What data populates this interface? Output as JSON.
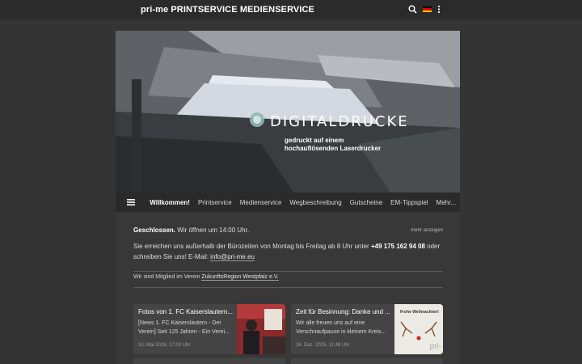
{
  "header": {
    "title": "pri-me PRINTSERVICE MEDIENSERVICE",
    "icons": [
      "search-icon",
      "flag-de-icon",
      "more-vert-icon"
    ]
  },
  "hero": {
    "title": "DIGITALDRUCKE",
    "subtitle": "gedruckt auf einem hochauflösenden Laserdrucker"
  },
  "nav": {
    "items": [
      {
        "label": "Willkommen!",
        "active": true
      },
      {
        "label": "Printservice"
      },
      {
        "label": "Medienservice"
      },
      {
        "label": "Wegbeschreibung"
      },
      {
        "label": "Gutscheine"
      },
      {
        "label": "EM-Tippspiel"
      },
      {
        "label": "Mehr..."
      }
    ]
  },
  "status": {
    "closed": "Geschlossen.",
    "opens": "Wir öffnen um 14:00 Uhr.",
    "more": "mehr anzeigen"
  },
  "info": {
    "text_before": "Sie erreichen uns außerhalb der Bürozeiten von Montag bis Freitag ab 8 Uhr unter",
    "phone": "+49 175 162 94 08",
    "text_after": "oder schreiben Sie uns! E-Mail:",
    "email": "info@pri-me.eu"
  },
  "member": {
    "text": "Wir sind Mitglied im Verein",
    "link": "ZukunftsRegion Westpfalz e.V."
  },
  "posts": [
    {
      "title": "Fotos von 1. FC Kaiserslautern...",
      "excerpt": "[News 1. FC Kaiserslautern - Der Verein] Seit 125 Jahren - Ein Verei...",
      "date": "10. Mai 2026, 17:00 Uhr"
    },
    {
      "title": "Zeit für Besinnung: Danke und ...",
      "excerpt": "Wir alle freuen uns auf eine Verschnaufpause in kleinem Kreis...",
      "date": "24. Dez. 2025, 11:48 Uhr",
      "image_text": "Frohe Weihnachten!",
      "image_brand": "pri-"
    }
  ],
  "colors": {
    "background": "#343434",
    "topbar": "#2b2b2b",
    "content": "#383838",
    "card": "#444444"
  }
}
